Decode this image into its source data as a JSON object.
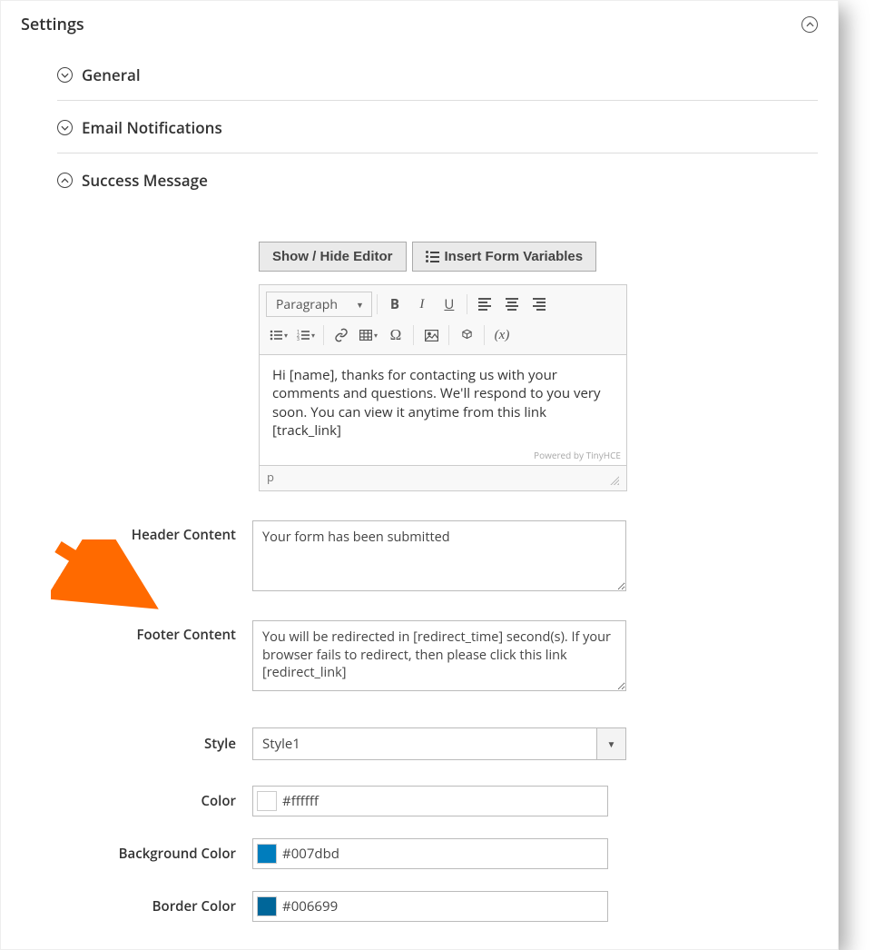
{
  "panel": {
    "title": "Settings"
  },
  "sections": {
    "general": "General",
    "email": "Email Notifications",
    "success": "Success Message"
  },
  "buttons": {
    "toggle_editor": "Show / Hide Editor",
    "insert_vars": "Insert Form Variables"
  },
  "editor": {
    "paragraph": "Paragraph",
    "content": "Hi [name], thanks for contacting us with your comments and questions. We'll respond to you very soon. You can view it anytime from this link [track_link]",
    "powered": "Powered by TinyHCE",
    "path": "p"
  },
  "fields": {
    "header_label": "Header Content",
    "header_value": "Your form has been submitted",
    "footer_label": "Footer Content",
    "footer_value": "You will be redirected in [redirect_time] second(s). If your browser fails to redirect, then please click this link [redirect_link]",
    "style_label": "Style",
    "style_value": "Style1",
    "color_label": "Color",
    "color_value": "#ffffff",
    "bg_label": "Background Color",
    "bg_value": "#007dbd",
    "border_label": "Border Color",
    "border_value": "#006699"
  },
  "colors": {
    "color_swatch": "#ffffff",
    "bg_swatch": "#007dbd",
    "border_swatch": "#006699"
  }
}
